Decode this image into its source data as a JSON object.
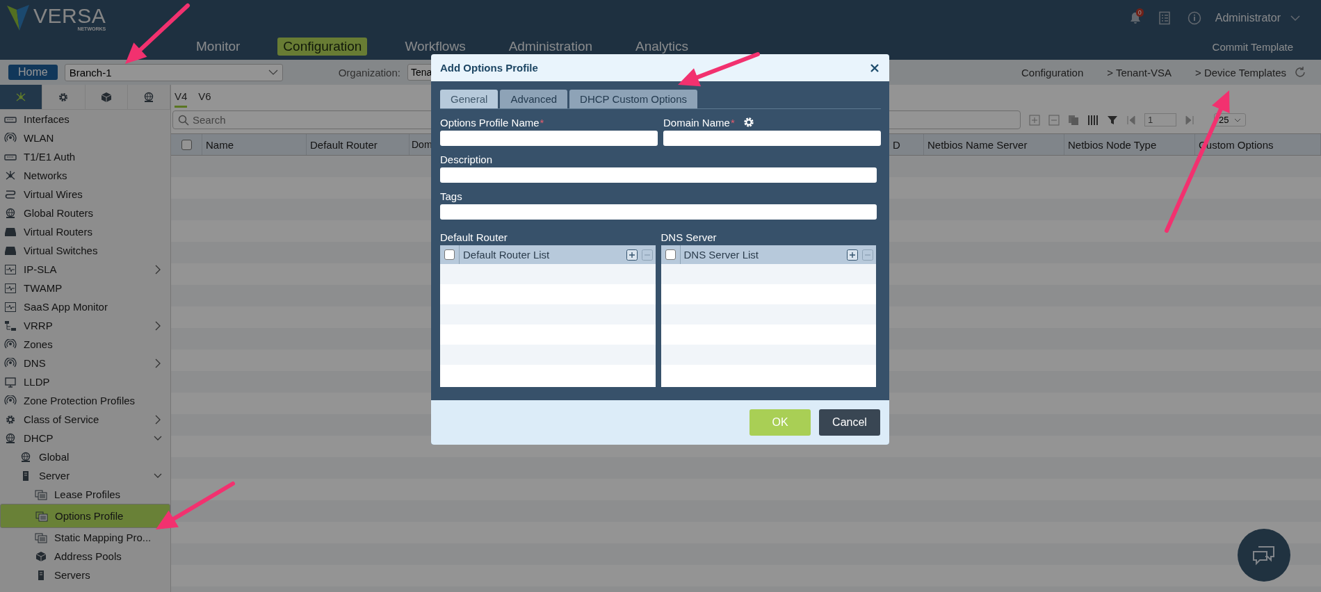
{
  "header": {
    "logo": "VERSA",
    "logo_sub": "NETWORKS",
    "nav": [
      {
        "label": "Monitor",
        "selected": false
      },
      {
        "label": "Configuration",
        "selected": true
      },
      {
        "label": "Workflows",
        "selected": false
      },
      {
        "label": "Administration",
        "selected": false
      },
      {
        "label": "Analytics",
        "selected": false
      }
    ],
    "notification_count": "0",
    "user": "Administrator",
    "commit": "Commit Template"
  },
  "context_bar": {
    "home": "Home",
    "branch": "Branch-1",
    "organization_label": "Organization:",
    "organization_value": "Tena",
    "breadcrumb": [
      "Configuration",
      "> Tenant-VSA",
      "> Device Templates"
    ]
  },
  "sidebar": {
    "tabs": [
      {
        "kind": "network",
        "selected": true
      },
      {
        "kind": "gear",
        "selected": false
      },
      {
        "kind": "cube",
        "selected": false
      },
      {
        "kind": "globe",
        "selected": false
      }
    ],
    "items": [
      {
        "label": "Interfaces",
        "kind": "port",
        "selected": false
      },
      {
        "label": "WLAN",
        "kind": "wifi",
        "selected": false
      },
      {
        "label": "T1/E1 Auth",
        "kind": "port",
        "selected": false
      },
      {
        "label": "Networks",
        "kind": "network",
        "selected": false
      },
      {
        "label": "Virtual Wires",
        "kind": "wires",
        "selected": false
      },
      {
        "label": "Global Routers",
        "kind": "globe",
        "selected": false
      },
      {
        "label": "Virtual Routers",
        "kind": "router",
        "selected": false
      },
      {
        "label": "Virtual Switches",
        "kind": "router",
        "selected": false
      },
      {
        "label": "IP-SLA",
        "kind": "pulse",
        "selected": false,
        "expanded": false
      },
      {
        "label": "TWAMP",
        "kind": "pulse",
        "selected": false
      },
      {
        "label": "SaaS App Monitor",
        "kind": "pulse",
        "selected": false
      },
      {
        "label": "VRRP",
        "kind": "tree",
        "selected": false,
        "expanded": false
      },
      {
        "label": "Zones",
        "kind": "wifi",
        "selected": false
      },
      {
        "label": "DNS",
        "kind": "wifi",
        "selected": false,
        "expanded": false
      },
      {
        "label": "LLDP",
        "kind": "screen",
        "selected": false
      },
      {
        "label": "Zone Protection Profiles",
        "kind": "wifi",
        "selected": false
      },
      {
        "label": "Class of Service",
        "kind": "gear",
        "selected": false,
        "expanded": false
      },
      {
        "label": "DHCP",
        "kind": "globe",
        "selected": false,
        "expanded": true,
        "children": [
          {
            "label": "Global",
            "kind": "globe",
            "selected": false
          },
          {
            "label": "Server",
            "kind": "server",
            "selected": false,
            "expanded": true,
            "children": [
              {
                "label": "Lease Profiles",
                "kind": "folder",
                "selected": false
              },
              {
                "label": "Options Profile",
                "kind": "folder",
                "selected": true
              },
              {
                "label": "Static Mapping Pro...",
                "kind": "folder",
                "selected": false
              },
              {
                "label": "Address Pools",
                "kind": "cube",
                "selected": false
              },
              {
                "label": "Servers",
                "kind": "server",
                "selected": false
              }
            ]
          }
        ]
      }
    ]
  },
  "main": {
    "tabs": [
      {
        "label": "V4",
        "selected": true
      },
      {
        "label": "V6",
        "selected": false
      }
    ],
    "search": {
      "placeholder": "Search"
    },
    "page": "1",
    "page_size": "25",
    "table": {
      "select_all_checked": false,
      "columns": [
        "Name",
        "Default Router",
        "Dom",
        "D",
        "Netbios Name Server",
        "Netbios Node Type",
        "Custom Options"
      ]
    }
  },
  "dialog": {
    "title": "Add Options Profile",
    "tabs": [
      {
        "label": "General",
        "selected": true
      },
      {
        "label": "Advanced",
        "selected": false
      },
      {
        "label": "DHCP Custom Options",
        "selected": false
      }
    ],
    "fields": [
      {
        "label": "Options Profile Name",
        "required_mark": "*"
      },
      {
        "label": "Domain Name",
        "required_mark": "*",
        "kind": "gear"
      },
      {
        "label": "Description"
      },
      {
        "label": "Tags"
      }
    ],
    "lists": [
      {
        "label": "Default Router",
        "column": "Default Router List",
        "select_all_checked": false
      },
      {
        "label": "DNS Server",
        "column": "DNS Server List",
        "select_all_checked": false
      }
    ],
    "buttons": [
      {
        "label": "OK",
        "kind": "primary"
      },
      {
        "label": "Cancel",
        "kind": "secondary"
      }
    ]
  }
}
